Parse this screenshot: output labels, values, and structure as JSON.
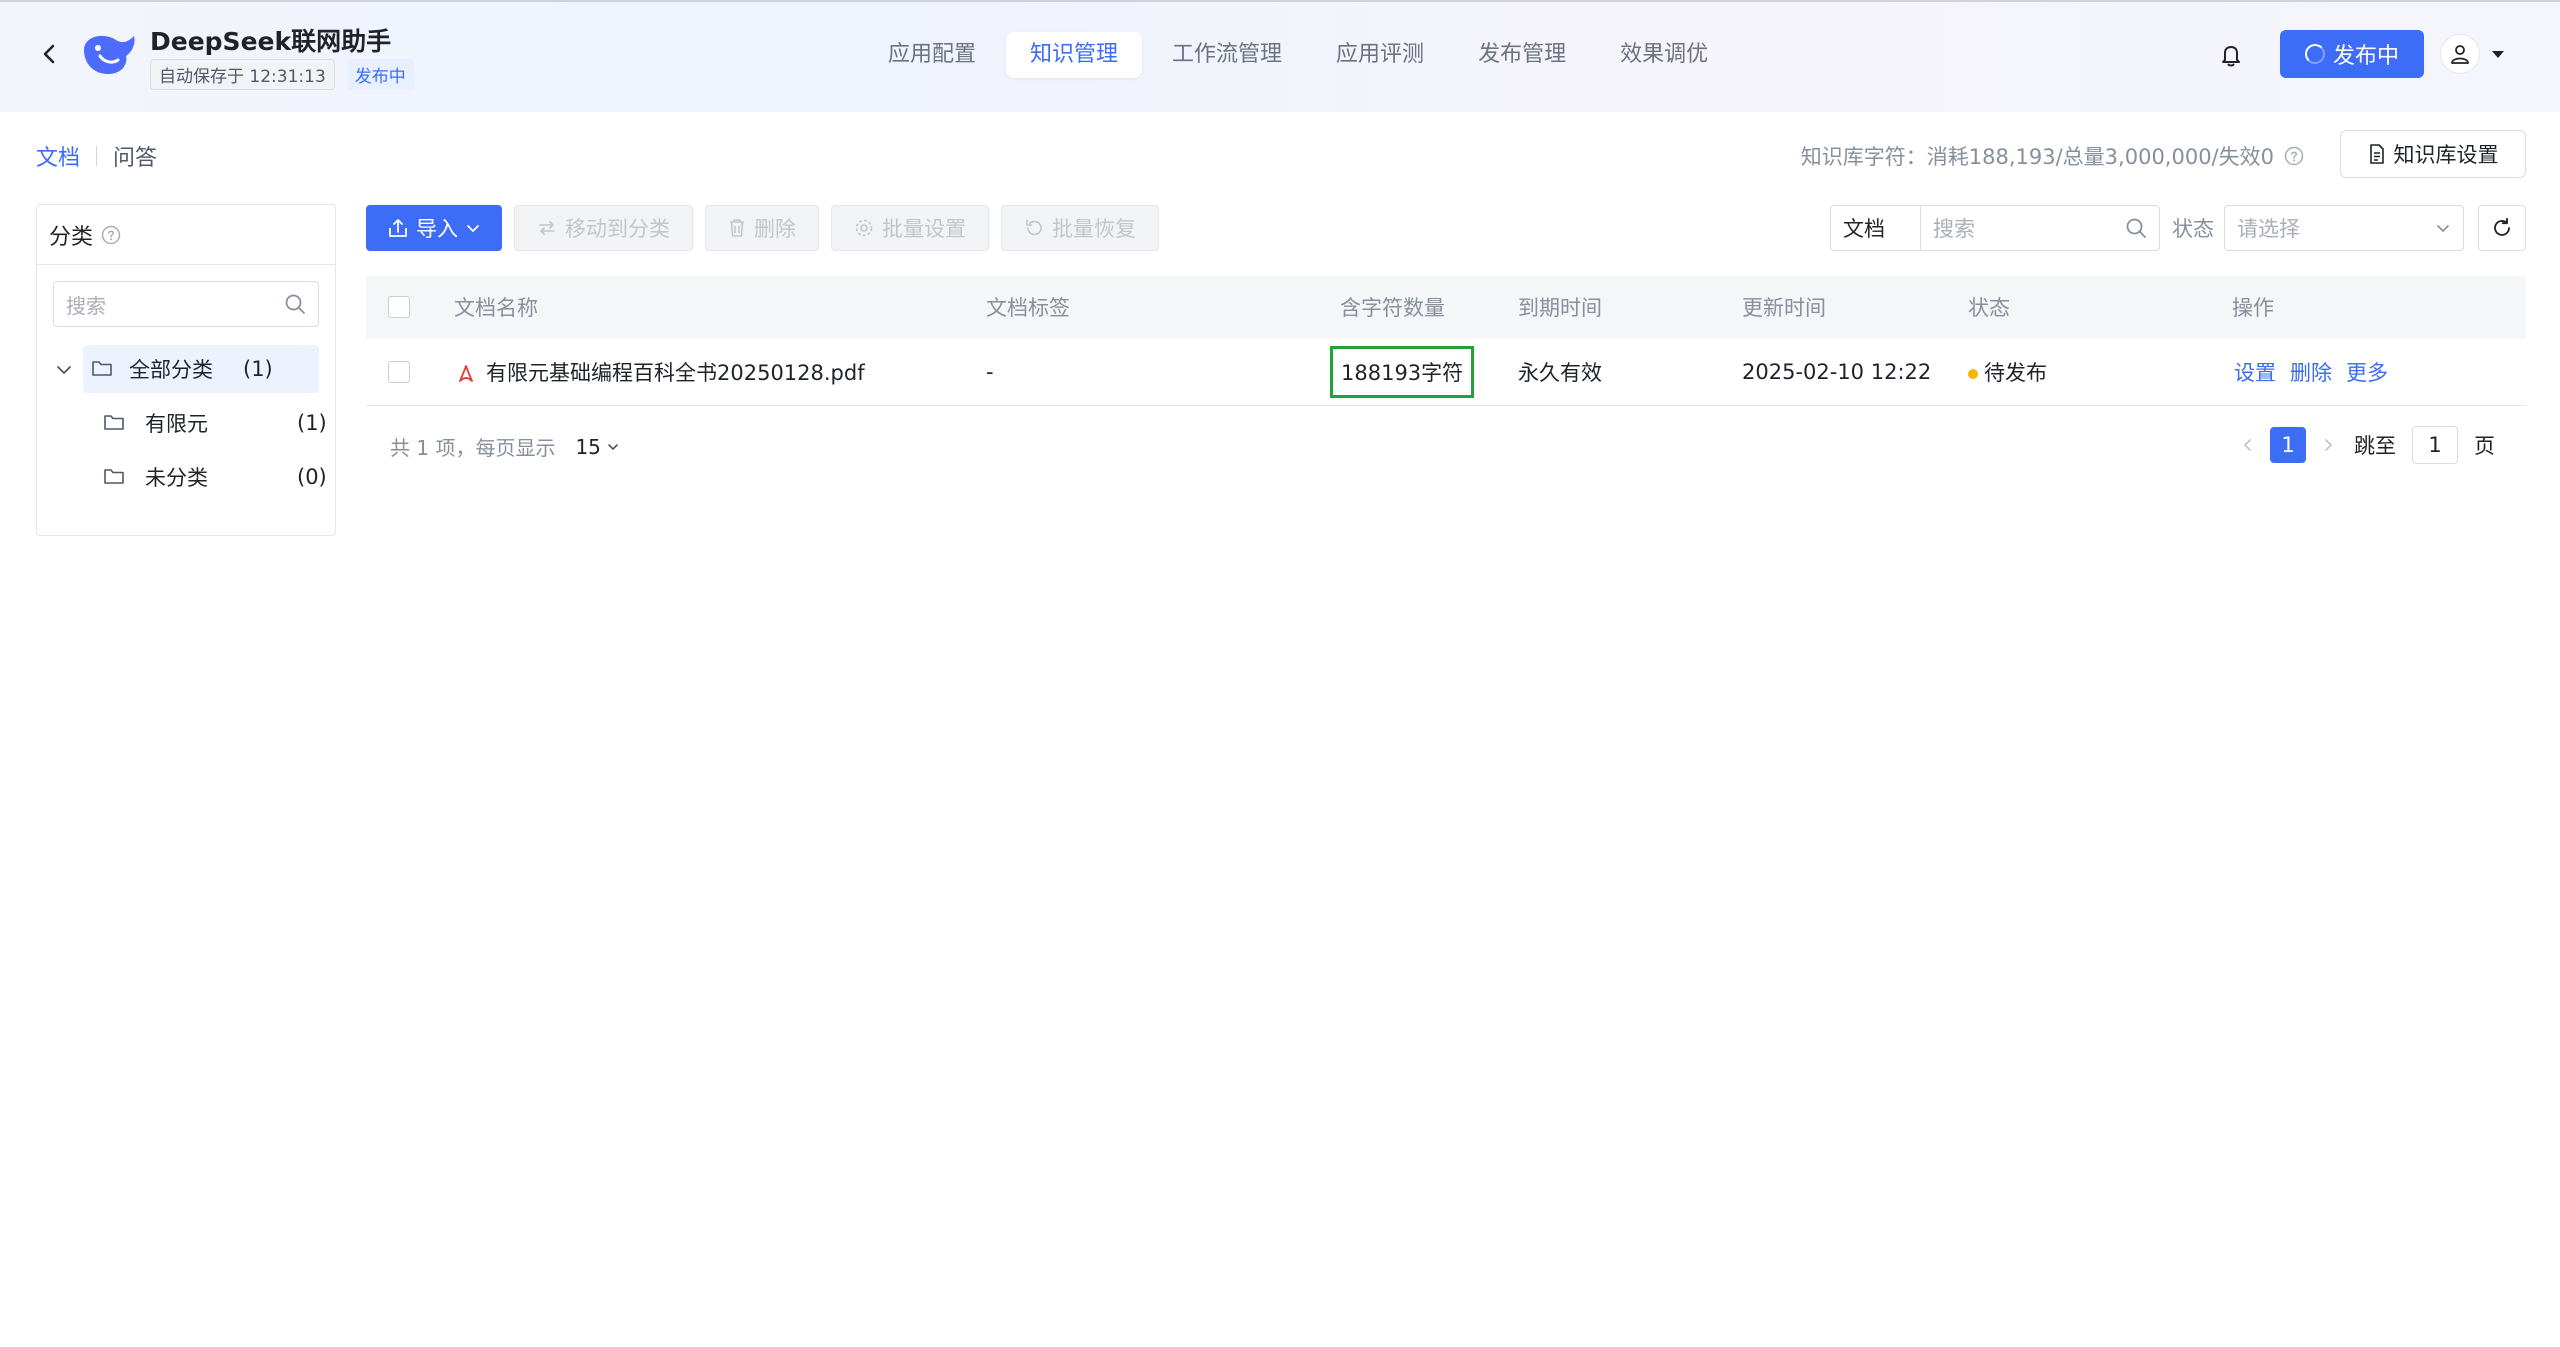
{
  "header": {
    "app_title": "DeepSeek联网助手",
    "autosave_text": "自动保存于 12:31:13",
    "status_tag": "发布中",
    "nav_tabs": [
      {
        "label": "应用配置"
      },
      {
        "label": "知识管理"
      },
      {
        "label": "工作流管理"
      },
      {
        "label": "应用评测"
      },
      {
        "label": "发布管理"
      },
      {
        "label": "效果调优"
      }
    ],
    "active_tab": "知识管理",
    "publish_button": "发布中"
  },
  "subtabs": [
    {
      "label": "文档"
    },
    {
      "label": "问答"
    }
  ],
  "kb_stats": "知识库字符：消耗188,193/总量3,000,000/失效0",
  "kb_settings_button": "知识库设置",
  "category_panel": {
    "title": "分类",
    "search_placeholder": "搜索",
    "tree": [
      {
        "label": "全部分类",
        "count": "(1)",
        "selected": true
      },
      {
        "label": "有限元",
        "count": "(1)"
      },
      {
        "label": "未分类",
        "count": "(0)"
      }
    ]
  },
  "toolbar": {
    "import": "导入",
    "move_to_category": "移动到分类",
    "delete": "删除",
    "batch_settings": "批量设置",
    "batch_restore": "批量恢复"
  },
  "filter": {
    "type": "文档",
    "search_placeholder": "搜索",
    "status_label": "状态",
    "status_placeholder": "请选择"
  },
  "table": {
    "columns": [
      "文档名称",
      "文档标签",
      "含字符数量",
      "到期时间",
      "更新时间",
      "状态",
      "操作"
    ],
    "rows": [
      {
        "name": "有限元基础编程百科全书20250128.pdf",
        "tags": "-",
        "chars": "188193字符",
        "expiry": "永久有效",
        "updated": "2025-02-10 12:22",
        "status": "待发布",
        "actions": [
          "设置",
          "删除",
          "更多"
        ]
      }
    ]
  },
  "pagination": {
    "summary": "共 1 项，每页显示",
    "page_size": "15",
    "current_page": "1",
    "jump_label": "跳至",
    "jump_value": "1",
    "page_suffix": "页"
  },
  "colors": {
    "primary": "#3d6cf6",
    "highlight_border": "#23a23a",
    "pending_dot": "#f7b500"
  }
}
